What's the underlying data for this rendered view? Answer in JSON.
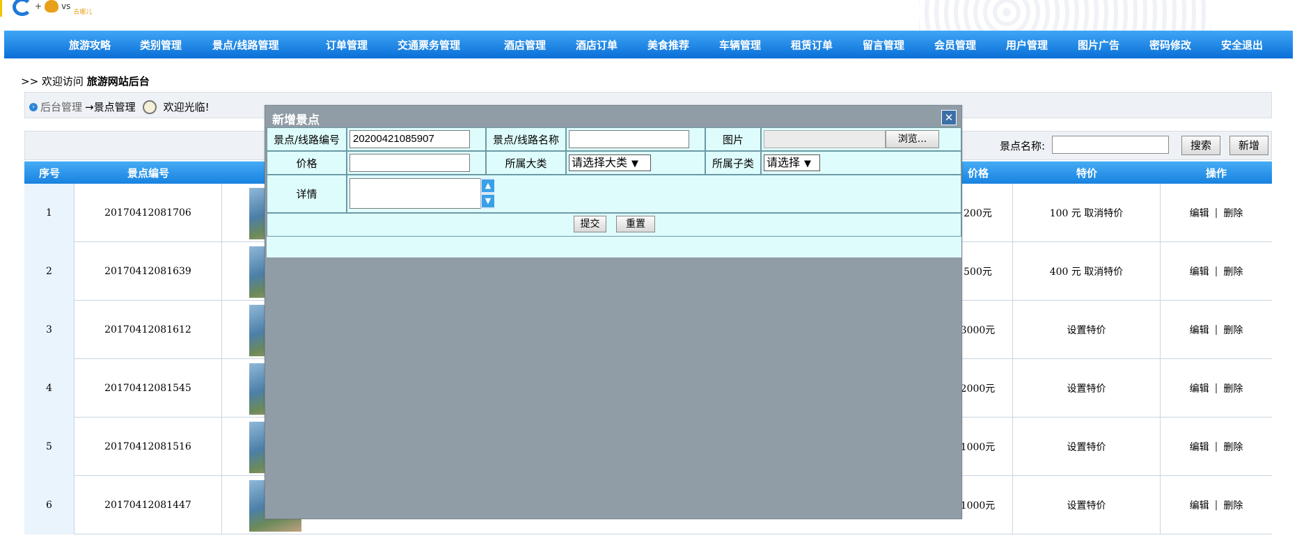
{
  "header": {
    "logo_plus": "+",
    "logo_vs": "vs",
    "logo_qu": "去哪儿"
  },
  "nav": [
    {
      "label": "旅游攻略"
    },
    {
      "label": "类别管理"
    },
    {
      "label": "景点/线路管理"
    },
    {
      "label": "订单管理"
    },
    {
      "label": "交通票务管理"
    },
    {
      "label": "酒店管理"
    },
    {
      "label": "酒店订单"
    },
    {
      "label": "美食推荐"
    },
    {
      "label": "车辆管理"
    },
    {
      "label": "租赁订单"
    },
    {
      "label": "留言管理"
    },
    {
      "label": "会员管理"
    },
    {
      "label": "用户管理"
    },
    {
      "label": "图片广告"
    },
    {
      "label": "密码修改"
    },
    {
      "label": "安全退出"
    }
  ],
  "welcome": {
    "prefix": ">> 欢迎访问",
    "site": "旅游网站后台"
  },
  "breadcrumb": {
    "home": "后台管理",
    "arrow_page": "→景点管理",
    "greeting": "欢迎光临!"
  },
  "search": {
    "label": "景点名称:",
    "value": "",
    "search_button": "搜索",
    "add_button": "新增"
  },
  "table": {
    "headers": {
      "index": "序号",
      "code": "景点编号",
      "price": "价格",
      "special": "特价",
      "ops": "操作"
    },
    "rows": [
      {
        "index": "1",
        "code": "20170412081706",
        "price": "200元",
        "special": "100 元 取消特价"
      },
      {
        "index": "2",
        "code": "20170412081639",
        "price": "500元",
        "special": "400 元 取消特价"
      },
      {
        "index": "3",
        "code": "20170412081612",
        "price": "3000元",
        "special": "设置特价"
      },
      {
        "index": "4",
        "code": "20170412081545",
        "price": "2000元",
        "special": "设置特价"
      },
      {
        "index": "5",
        "code": "20170412081516",
        "price": "1000元",
        "special": "设置特价"
      },
      {
        "index": "6",
        "code": "20170412081447",
        "price": "1000元",
        "special": "设置特价"
      }
    ],
    "edit_label": "编辑",
    "separator": "|",
    "delete_label": "删除"
  },
  "modal": {
    "title": "新增景点",
    "close_symbol": "✕",
    "fields": {
      "code_label": "景点/线路编号",
      "code_value": "20200421085907",
      "name_label": "景点/线路名称",
      "name_value": "",
      "image_label": "图片",
      "browse_button": "浏览...",
      "price_label": "价格",
      "price_value": "",
      "category_label": "所属大类",
      "category_selected": "请选择大类",
      "subcategory_label": "所属子类",
      "subcategory_selected": "请选择",
      "detail_label": "详情"
    },
    "submit_button": "提交",
    "reset_button": "重置"
  }
}
